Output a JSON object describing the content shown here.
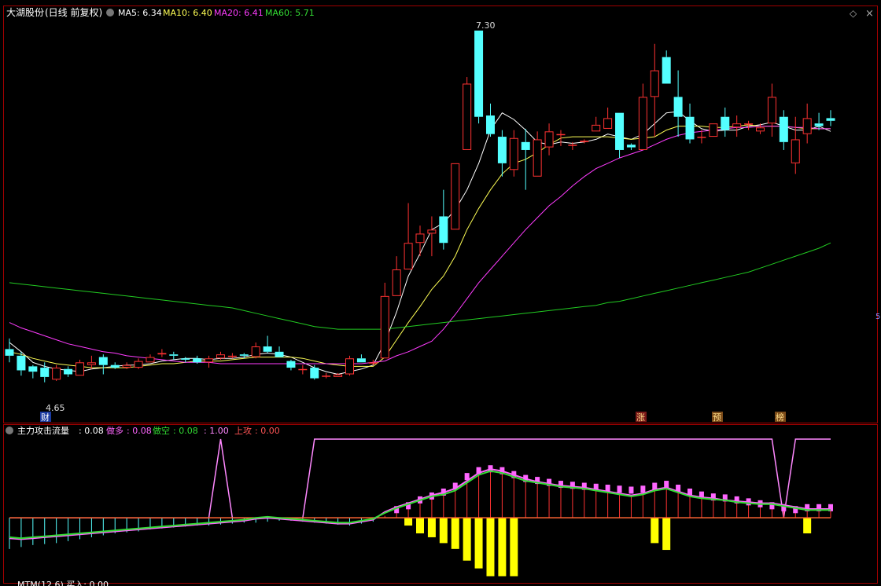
{
  "header": {
    "stock_name": "大湖股份",
    "period": "(日线 前复权)",
    "ma5": "MA5: 6.34",
    "ma10": "MA10: 6.40",
    "ma20": "MA20: 6.41",
    "ma60": "MA60: 5.71",
    "diamond_glyph": "◇",
    "close_glyph": "×",
    "side_tick": "5"
  },
  "indicator": {
    "name": "主力攻击流量",
    "value": ": 0.08",
    "duo_label": "做多",
    "duo_value": ": 0.08",
    "kong_label": "做空",
    "kong_value": ": 0.08",
    "extra_value": ": 1.00",
    "gong_label": "上攻",
    "gong_value": ": 0.00"
  },
  "bottom_panel": {
    "label": "MTM(12,6)  买入: 0.00"
  },
  "markers": {
    "high_label": "7.30",
    "low_label": "4.65",
    "cai": "财",
    "zhang": "涨",
    "yu": "预",
    "bang": "榜"
  },
  "colors": {
    "up": "#ff3232",
    "down": "#54ffff",
    "ma5": "#ffffff",
    "ma10": "#ffff55",
    "ma20": "#ff3cff",
    "ma60": "#22cc22",
    "panel_border": "#a00000",
    "ind_pink": "#ff66ff",
    "ind_green": "#33dd33",
    "ind_yellow": "#ffff00",
    "ind_red": "#ff3232",
    "ind_cyan": "#55ffff",
    "ind_line": "#ff88ff"
  },
  "chart_data": [
    {
      "type": "candlestick",
      "title": "大湖股份 (日线 前复权)",
      "ylim": [
        4.5,
        7.4
      ],
      "candles": [
        [
          4.9,
          4.85,
          4.98,
          4.8
        ],
        [
          4.85,
          4.74,
          4.88,
          4.7
        ],
        [
          4.77,
          4.73,
          4.78,
          4.68
        ],
        [
          4.76,
          4.69,
          4.8,
          4.65
        ],
        [
          4.67,
          4.76,
          4.78,
          4.66
        ],
        [
          4.75,
          4.71,
          4.77,
          4.69
        ],
        [
          4.7,
          4.8,
          4.82,
          4.7
        ],
        [
          4.78,
          4.8,
          4.85,
          4.75
        ],
        [
          4.84,
          4.78,
          4.86,
          4.71
        ],
        [
          4.78,
          4.76,
          4.8,
          4.75
        ],
        [
          4.76,
          4.78,
          4.8,
          4.75
        ],
        [
          4.76,
          4.81,
          4.83,
          4.75
        ],
        [
          4.8,
          4.84,
          4.86,
          4.8
        ],
        [
          4.86,
          4.87,
          4.9,
          4.84
        ],
        [
          4.86,
          4.85,
          4.88,
          4.82
        ],
        [
          4.83,
          4.82,
          4.84,
          4.8
        ],
        [
          4.83,
          4.8,
          4.85,
          4.79
        ],
        [
          4.8,
          4.83,
          4.85,
          4.76
        ],
        [
          4.83,
          4.86,
          4.88,
          4.82
        ],
        [
          4.85,
          4.85,
          4.87,
          4.83
        ],
        [
          4.86,
          4.85,
          4.87,
          4.83
        ],
        [
          4.84,
          4.92,
          4.95,
          4.83
        ],
        [
          4.92,
          4.88,
          5.0,
          4.87
        ],
        [
          4.88,
          4.84,
          4.92,
          4.84
        ],
        [
          4.81,
          4.76,
          4.82,
          4.74
        ],
        [
          4.75,
          4.75,
          4.78,
          4.71
        ],
        [
          4.76,
          4.68,
          4.78,
          4.67
        ],
        [
          4.7,
          4.7,
          4.72,
          4.68
        ],
        [
          4.69,
          4.71,
          4.72,
          4.69
        ],
        [
          4.71,
          4.83,
          4.85,
          4.7
        ],
        [
          4.83,
          4.8,
          4.86,
          4.8
        ],
        [
          4.8,
          4.8,
          4.82,
          4.78
        ],
        [
          4.83,
          5.3,
          5.4,
          4.83
        ],
        [
          5.3,
          5.5,
          5.6,
          5.3
        ],
        [
          5.5,
          5.7,
          6.0,
          5.5
        ],
        [
          5.7,
          5.77,
          5.83,
          5.6
        ],
        [
          5.77,
          5.8,
          5.9,
          5.6
        ],
        [
          5.9,
          5.7,
          6.1,
          5.65
        ],
        [
          5.8,
          6.3,
          6.3,
          5.8
        ],
        [
          6.4,
          6.9,
          6.95,
          6.4
        ],
        [
          7.3,
          6.65,
          7.3,
          6.6
        ],
        [
          6.66,
          6.52,
          6.75,
          6.5
        ],
        [
          6.5,
          6.3,
          6.55,
          6.2
        ],
        [
          6.25,
          6.49,
          6.55,
          6.2
        ],
        [
          6.46,
          6.4,
          6.56,
          6.1
        ],
        [
          6.2,
          6.48,
          6.54,
          6.2
        ],
        [
          6.42,
          6.54,
          6.6,
          6.36
        ],
        [
          6.52,
          6.52,
          6.55,
          6.43
        ],
        [
          6.44,
          6.44,
          6.46,
          6.4
        ],
        [
          6.46,
          6.47,
          6.48,
          6.45
        ],
        [
          6.54,
          6.59,
          6.65,
          6.54
        ],
        [
          6.56,
          6.64,
          6.72,
          6.56
        ],
        [
          6.68,
          6.4,
          6.68,
          6.34
        ],
        [
          6.44,
          6.42,
          6.45,
          6.4
        ],
        [
          6.4,
          6.8,
          6.9,
          6.4
        ],
        [
          6.8,
          7.0,
          7.2,
          6.5
        ],
        [
          7.1,
          6.9,
          7.15,
          6.9
        ],
        [
          6.8,
          6.65,
          7.0,
          6.5
        ],
        [
          6.65,
          6.48,
          6.75,
          6.45
        ],
        [
          6.5,
          6.5,
          6.55,
          6.45
        ],
        [
          6.5,
          6.6,
          6.6,
          6.55
        ],
        [
          6.65,
          6.55,
          6.72,
          6.5
        ],
        [
          6.57,
          6.6,
          6.66,
          6.5
        ],
        [
          6.6,
          6.6,
          6.62,
          6.55
        ],
        [
          6.54,
          6.57,
          6.6,
          6.52
        ],
        [
          6.6,
          6.8,
          6.9,
          6.5
        ],
        [
          6.65,
          6.46,
          6.7,
          6.4
        ],
        [
          6.3,
          6.48,
          6.65,
          6.22
        ],
        [
          6.52,
          6.64,
          6.75,
          6.45
        ],
        [
          6.6,
          6.58,
          6.68,
          6.55
        ],
        [
          6.64,
          6.62,
          6.7,
          6.58
        ]
      ],
      "ma_lines": [
        {
          "name": "MA5",
          "values": [
            4.95,
            4.88,
            4.8,
            4.77,
            4.75,
            4.74,
            4.73,
            4.75,
            4.76,
            4.77,
            4.78,
            4.78,
            4.79,
            4.81,
            4.82,
            4.83,
            4.83,
            4.82,
            4.83,
            4.83,
            4.84,
            4.86,
            4.87,
            4.86,
            4.84,
            4.8,
            4.76,
            4.73,
            4.71,
            4.73,
            4.75,
            4.78,
            4.95,
            5.18,
            5.45,
            5.62,
            5.8,
            5.85,
            5.95,
            6.1,
            6.3,
            6.55,
            6.68,
            6.63,
            6.55,
            6.46,
            6.44,
            6.46,
            6.45,
            6.46,
            6.48,
            6.52,
            6.5,
            6.48,
            6.52,
            6.6,
            6.68,
            6.69,
            6.62,
            6.56,
            6.54,
            6.55,
            6.55,
            6.58,
            6.59,
            6.61,
            6.58,
            6.55,
            6.55,
            6.58,
            6.54
          ]
        },
        {
          "name": "MA10",
          "values": [
            4.88,
            4.86,
            4.83,
            4.81,
            4.79,
            4.78,
            4.77,
            4.76,
            4.76,
            4.76,
            4.76,
            4.77,
            4.78,
            4.79,
            4.79,
            4.8,
            4.81,
            4.81,
            4.81,
            4.82,
            4.83,
            4.84,
            4.84,
            4.84,
            4.84,
            4.83,
            4.81,
            4.79,
            4.78,
            4.77,
            4.77,
            4.77,
            4.84,
            4.97,
            5.1,
            5.22,
            5.35,
            5.45,
            5.6,
            5.8,
            5.96,
            6.1,
            6.22,
            6.3,
            6.33,
            6.38,
            6.44,
            6.49,
            6.5,
            6.5,
            6.5,
            6.5,
            6.49,
            6.48,
            6.49,
            6.5,
            6.55,
            6.58,
            6.58,
            6.58,
            6.57,
            6.57,
            6.58,
            6.59,
            6.58,
            6.58,
            6.58,
            6.57,
            6.56,
            6.56,
            6.56
          ]
        },
        {
          "name": "MA20",
          "values": [
            5.1,
            5.06,
            5.03,
            5.0,
            4.97,
            4.94,
            4.92,
            4.9,
            4.88,
            4.87,
            4.85,
            4.84,
            4.83,
            4.82,
            4.81,
            4.8,
            4.8,
            4.8,
            4.79,
            4.79,
            4.79,
            4.79,
            4.79,
            4.79,
            4.79,
            4.79,
            4.79,
            4.79,
            4.79,
            4.79,
            4.79,
            4.8,
            4.81,
            4.85,
            4.88,
            4.92,
            4.96,
            5.05,
            5.16,
            5.28,
            5.4,
            5.5,
            5.6,
            5.7,
            5.8,
            5.89,
            5.98,
            6.05,
            6.13,
            6.2,
            6.26,
            6.3,
            6.34,
            6.37,
            6.4,
            6.44,
            6.48,
            6.51,
            6.53,
            6.54,
            6.55,
            6.56,
            6.57,
            6.57,
            6.58,
            6.58,
            6.58,
            6.57,
            6.57,
            6.56,
            6.56
          ]
        },
        {
          "name": "MA60",
          "values": [
            5.4,
            5.39,
            5.38,
            5.37,
            5.36,
            5.35,
            5.34,
            5.33,
            5.32,
            5.31,
            5.3,
            5.29,
            5.28,
            5.27,
            5.26,
            5.25,
            5.24,
            5.23,
            5.22,
            5.21,
            5.19,
            5.17,
            5.15,
            5.13,
            5.11,
            5.09,
            5.07,
            5.06,
            5.05,
            5.05,
            5.05,
            5.05,
            5.05,
            5.06,
            5.07,
            5.08,
            5.09,
            5.1,
            5.11,
            5.12,
            5.13,
            5.14,
            5.15,
            5.16,
            5.17,
            5.18,
            5.19,
            5.2,
            5.21,
            5.22,
            5.23,
            5.25,
            5.26,
            5.28,
            5.3,
            5.32,
            5.34,
            5.36,
            5.38,
            5.4,
            5.42,
            5.44,
            5.46,
            5.48,
            5.51,
            5.54,
            5.57,
            5.6,
            5.63,
            5.66,
            5.7
          ]
        }
      ]
    },
    {
      "type": "bar",
      "title": "主力攻击流量",
      "ylim": [
        -0.62,
        0.8
      ],
      "bars_red": [
        -0.32,
        -0.3,
        -0.28,
        -0.27,
        -0.26,
        -0.24,
        -0.22,
        -0.2,
        -0.18,
        -0.16,
        -0.15,
        -0.14,
        -0.12,
        -0.11,
        -0.1,
        -0.09,
        -0.08,
        -0.08,
        -0.07,
        -0.06,
        -0.05,
        -0.05,
        -0.04,
        -0.03,
        -0.03,
        -0.04,
        -0.05,
        -0.06,
        -0.07,
        -0.08,
        -0.06,
        -0.04,
        0.02,
        0.06,
        0.1,
        0.16,
        0.22,
        0.26,
        0.3,
        0.4,
        0.46,
        0.48,
        0.46,
        0.42,
        0.38,
        0.36,
        0.34,
        0.33,
        0.32,
        0.31,
        0.29,
        0.27,
        0.24,
        0.23,
        0.26,
        0.3,
        0.32,
        0.28,
        0.24,
        0.2,
        0.19,
        0.18,
        0.16,
        0.15,
        0.14,
        0.15,
        0.12,
        0.1,
        0.08,
        0.08,
        0.08
      ],
      "bars_pink": [
        0,
        0,
        0,
        0,
        0,
        0,
        0,
        0,
        0,
        0,
        0,
        0,
        0,
        0,
        0,
        0,
        0,
        0,
        0,
        0,
        0,
        0,
        0,
        0,
        0,
        0,
        0,
        0,
        0,
        0,
        0,
        0,
        0,
        0.12,
        0.16,
        0.22,
        0.26,
        0.3,
        0.36,
        0.46,
        0.52,
        0.54,
        0.52,
        0.48,
        0.44,
        0.42,
        0.4,
        0.38,
        0.37,
        0.36,
        0.35,
        0.34,
        0.33,
        0.32,
        0.33,
        0.36,
        0.38,
        0.34,
        0.3,
        0.27,
        0.25,
        0.24,
        0.22,
        0.2,
        0.18,
        0.16,
        0.14,
        0.12,
        0.14,
        0.14,
        0.14
      ],
      "bars_yellow": [
        0,
        0,
        0,
        0,
        0,
        0,
        0,
        0,
        0,
        0,
        0,
        0,
        0,
        0,
        0,
        0,
        0,
        0,
        0,
        0,
        0,
        0,
        0,
        0,
        0,
        0,
        0,
        0,
        0,
        0,
        0,
        0,
        0,
        0,
        -0.08,
        -0.16,
        -0.2,
        -0.26,
        -0.32,
        -0.44,
        -0.52,
        -0.6,
        -0.6,
        -0.6,
        0,
        0,
        0,
        0,
        0,
        0,
        0,
        0,
        0,
        0,
        0,
        -0.26,
        -0.33,
        0,
        0,
        0,
        0,
        0,
        0,
        0,
        0,
        0,
        0,
        0,
        -0.16,
        0,
        0
      ],
      "green_line": [
        -0.2,
        -0.21,
        -0.2,
        -0.19,
        -0.18,
        -0.17,
        -0.16,
        -0.15,
        -0.14,
        -0.13,
        -0.12,
        -0.11,
        -0.1,
        -0.09,
        -0.08,
        -0.07,
        -0.06,
        -0.05,
        -0.04,
        -0.03,
        -0.02,
        0.0,
        0.01,
        0.0,
        -0.01,
        -0.02,
        -0.03,
        -0.04,
        -0.05,
        -0.05,
        -0.03,
        -0.01,
        0.05,
        0.1,
        0.14,
        0.18,
        0.22,
        0.24,
        0.28,
        0.36,
        0.44,
        0.48,
        0.46,
        0.42,
        0.38,
        0.36,
        0.34,
        0.32,
        0.31,
        0.3,
        0.28,
        0.26,
        0.24,
        0.22,
        0.24,
        0.28,
        0.3,
        0.26,
        0.22,
        0.2,
        0.19,
        0.18,
        0.16,
        0.15,
        0.14,
        0.14,
        0.12,
        0.1,
        0.08,
        0.08,
        0.08
      ],
      "pink_line": [
        -0.21,
        -0.22,
        -0.21,
        -0.2,
        -0.19,
        -0.18,
        -0.17,
        -0.16,
        -0.15,
        -0.14,
        -0.13,
        -0.12,
        -0.11,
        -0.1,
        -0.09,
        -0.08,
        -0.07,
        -0.06,
        -0.05,
        -0.04,
        -0.03,
        -0.01,
        0.0,
        -0.01,
        -0.02,
        -0.03,
        -0.04,
        -0.05,
        -0.06,
        -0.06,
        -0.04,
        -0.02,
        0.06,
        0.11,
        0.15,
        0.19,
        0.23,
        0.26,
        0.3,
        0.38,
        0.46,
        0.5,
        0.48,
        0.44,
        0.4,
        0.37,
        0.35,
        0.33,
        0.32,
        0.31,
        0.29,
        0.27,
        0.25,
        0.23,
        0.25,
        0.29,
        0.31,
        0.27,
        0.23,
        0.21,
        0.2,
        0.18,
        0.17,
        0.16,
        0.15,
        0.15,
        0.13,
        0.11,
        0.09,
        0.09,
        0.09
      ],
      "signal": [
        0,
        0,
        0,
        0,
        0,
        0,
        0,
        0,
        0,
        0,
        0,
        0,
        0,
        0,
        0,
        0,
        0,
        0,
        1,
        0,
        0,
        0,
        0,
        0,
        0,
        0,
        1,
        1,
        1,
        1,
        1,
        1,
        1,
        1,
        1,
        1,
        1,
        1,
        1,
        1,
        1,
        1,
        1,
        1,
        1,
        1,
        1,
        1,
        1,
        1,
        1,
        1,
        1,
        1,
        1,
        1,
        1,
        1,
        1,
        1,
        1,
        1,
        1,
        1,
        1,
        1,
        0,
        1,
        1,
        1,
        1
      ]
    }
  ]
}
